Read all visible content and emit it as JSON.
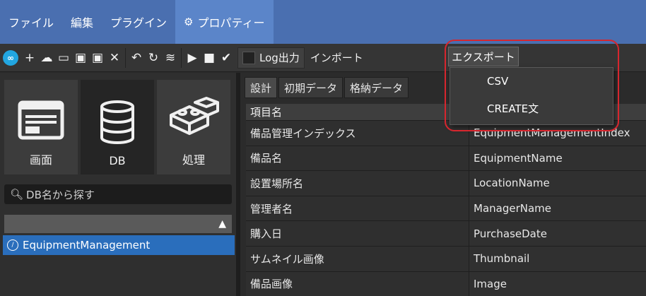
{
  "menubar": {
    "items": [
      "ファイル",
      "編集",
      "プラグイン"
    ],
    "active_item": "プロパティー"
  },
  "toolbar": {
    "icons": [
      "logo-icon",
      "add-icon",
      "cloud-icon",
      "window-icon",
      "save-icon",
      "save-all-icon",
      "close-icon",
      "undo-icon",
      "refresh-icon",
      "wifi-icon",
      "play-icon",
      "stop-icon",
      "check-icon"
    ],
    "log_label": "Log出力",
    "import_label": "インポート",
    "export_label": "エクスポート"
  },
  "left": {
    "buttons": [
      "画面",
      "DB",
      "処理"
    ],
    "search_placeholder": "DB名から探す",
    "list_item": "EquipmentManagement"
  },
  "right": {
    "tabs": [
      "設計",
      "初期データ",
      "格納データ"
    ],
    "grid_header": "項目名",
    "rows": [
      {
        "name": "備品管理インデックス",
        "value": "EquipmentManagementIndex"
      },
      {
        "name": "備品名",
        "value": "EquipmentName"
      },
      {
        "name": "設置場所名",
        "value": "LocationName"
      },
      {
        "name": "管理者名",
        "value": "ManagerName"
      },
      {
        "name": "購入日",
        "value": "PurchaseDate"
      },
      {
        "name": "サムネイル画像",
        "value": "Thumbnail"
      },
      {
        "name": "備品画像",
        "value": "Image"
      }
    ]
  },
  "dropdown": {
    "items": [
      "CSV",
      "CREATE文"
    ]
  },
  "colors": {
    "menubar": "#4a6fb0",
    "selection": "#2a6ebc",
    "highlight": "#d7262e"
  }
}
